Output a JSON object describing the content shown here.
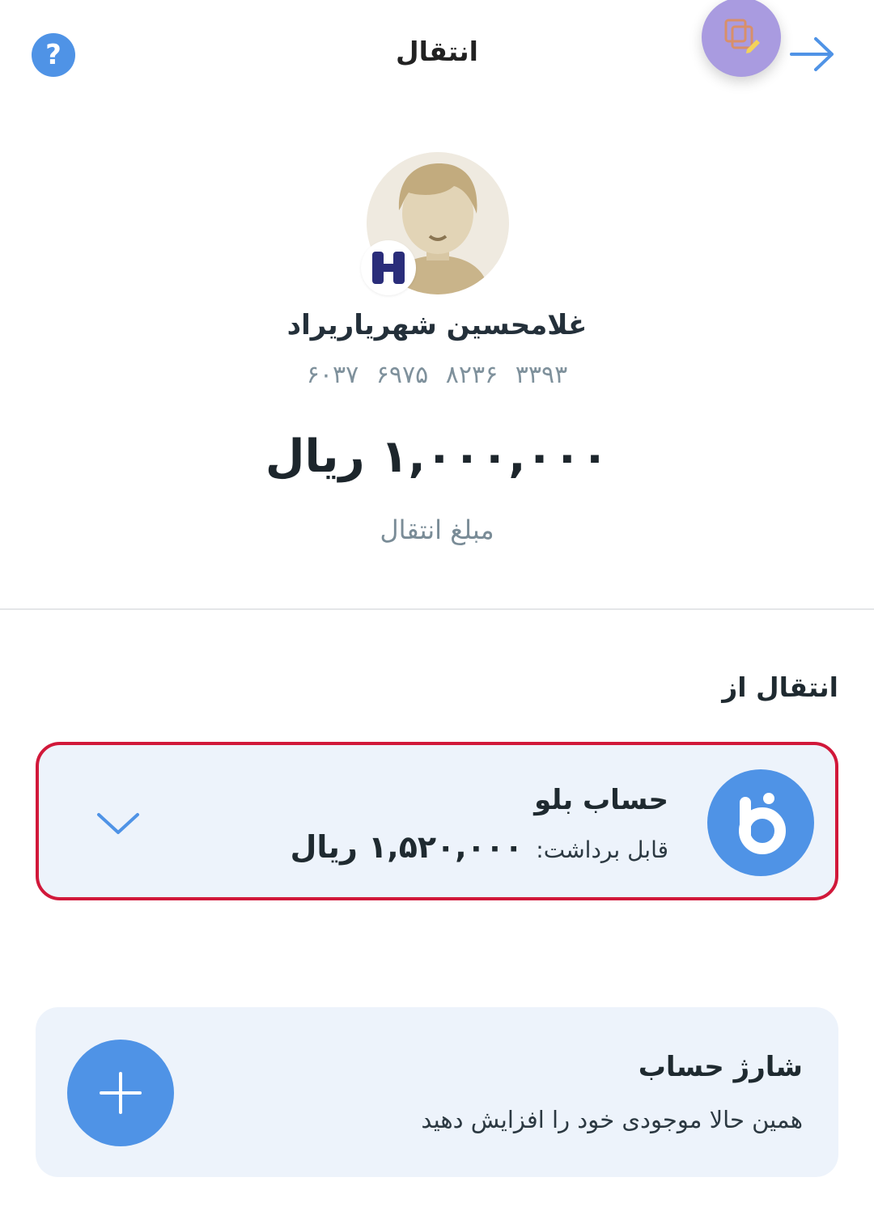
{
  "header": {
    "title": "انتقال",
    "help_label": "?",
    "help_icon": "question-icon",
    "edit_icon": "copy-edit-icon",
    "back_icon": "arrow-right-icon"
  },
  "recipient": {
    "name": "غلامحسین شهریاریراد",
    "card_number": "۶۰۳۷ ۶۹۷۵ ۸۲۳۶ ۳۳۹۳",
    "bank_icon": "bank-saderat-icon"
  },
  "transfer": {
    "amount": "۱,۰۰۰,۰۰۰ ریال",
    "amount_label": "مبلغ انتقال"
  },
  "source": {
    "section_title": "انتقال از",
    "account_name": "حساب بلو",
    "withdraw_label": "قابل برداشت:",
    "withdraw_value": "۱,۵۲۰,۰۰۰ ریال",
    "selected": true
  },
  "charge": {
    "title": "شارژ حساب",
    "subtitle": "همین حالا موجودی خود را افزایش دهید"
  },
  "colors": {
    "accent": "#4f93e6",
    "selected_border": "#d1183a",
    "card_background": "#edf3fb",
    "edit_fab": "#a99be0"
  }
}
